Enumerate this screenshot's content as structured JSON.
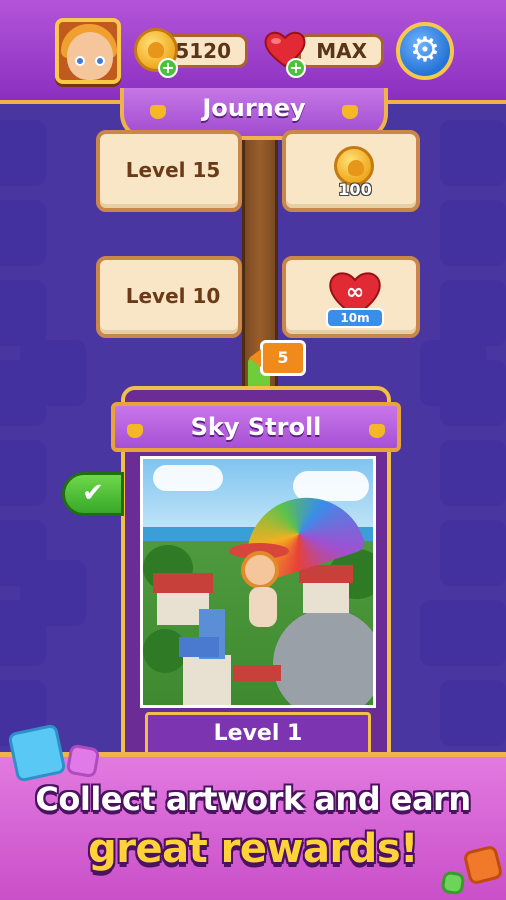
{
  "header": {
    "coins": "5120",
    "lives": "MAX"
  },
  "journey": {
    "title": "Journey"
  },
  "levels": [
    {
      "label": "Level 15",
      "reward_text": "100",
      "reward_icon": "coin-icon"
    },
    {
      "label": "Level 10",
      "reward_text": "10m",
      "reward_icon": "infinite-heart-icon"
    }
  ],
  "marker": {
    "value": "5"
  },
  "card": {
    "title": "Sky Stroll",
    "level": "Level 1"
  },
  "promo": {
    "line1": "Collect artwork and earn",
    "line2": "great rewards!"
  },
  "colors": {
    "background": "#3e2c8c",
    "header": "#a04cd0",
    "accent_gold": "#f2b24a",
    "promo": "#d45fd2",
    "promo_highlight": "#ffd23a"
  }
}
